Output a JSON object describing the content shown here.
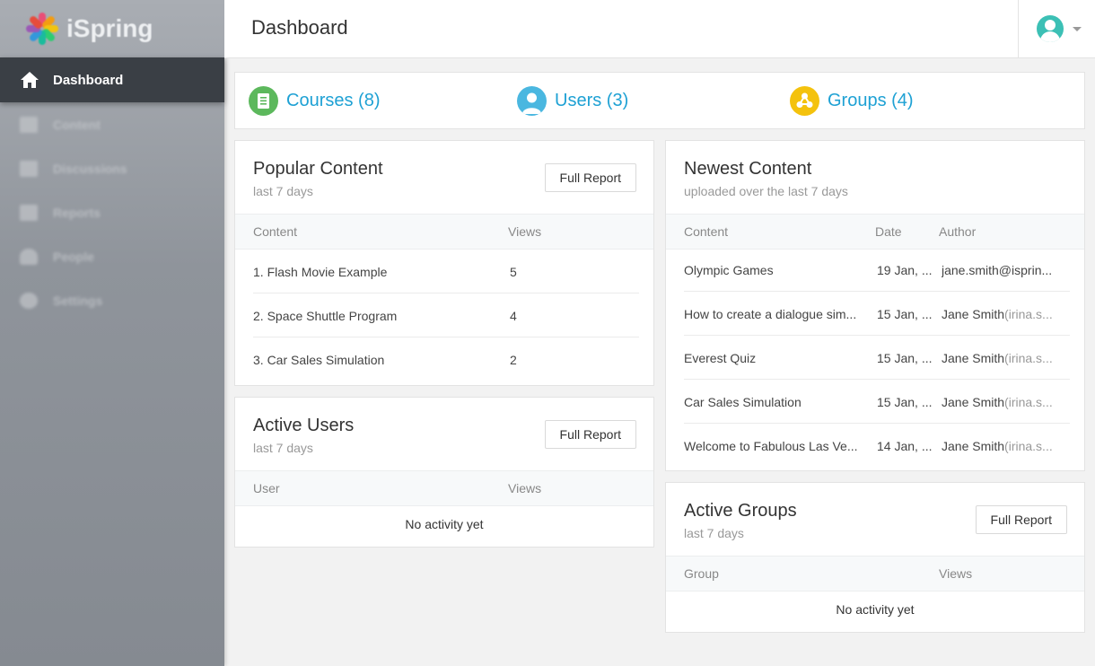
{
  "brand": {
    "name": "iSpring"
  },
  "sidebar": {
    "items": [
      {
        "label": "Dashboard",
        "icon": "home-icon",
        "active": true
      },
      {
        "label": "Content",
        "icon": "content-icon"
      },
      {
        "label": "Discussions",
        "icon": "discussions-icon"
      },
      {
        "label": "Reports",
        "icon": "reports-icon"
      },
      {
        "label": "People",
        "icon": "people-icon"
      },
      {
        "label": "Settings",
        "icon": "settings-icon"
      }
    ]
  },
  "header": {
    "title": "Dashboard"
  },
  "summary": {
    "courses": "Courses (8)",
    "users": "Users (3)",
    "groups": "Groups (4)"
  },
  "colors": {
    "courses": "#5cb85c",
    "users": "#4ab7e0",
    "groups": "#f4c20d",
    "link": "#1ea1d4"
  },
  "popular": {
    "title": "Popular Content",
    "subtitle": "last 7 days",
    "button": "Full Report",
    "col_content": "Content",
    "col_views": "Views",
    "rows": [
      {
        "content": "1. Flash Movie Example",
        "views": "5"
      },
      {
        "content": "2. Space Shuttle Program",
        "views": "4"
      },
      {
        "content": "3. Car Sales Simulation",
        "views": "2"
      }
    ]
  },
  "active_users": {
    "title": "Active Users",
    "subtitle": "last 7 days",
    "button": "Full Report",
    "col_user": "User",
    "col_views": "Views",
    "empty": "No activity yet"
  },
  "newest": {
    "title": "Newest Content",
    "subtitle": "uploaded over the last 7 days",
    "col_content": "Content",
    "col_date": "Date",
    "col_author": "Author",
    "rows": [
      {
        "content": "Olympic Games",
        "date": "19 Jan, ...",
        "author": "jane.smith@isprin...",
        "author_extra": ""
      },
      {
        "content": "How to create a dialogue sim...",
        "date": "15 Jan, ...",
        "author": "Jane Smith",
        "author_extra": "(irina.s..."
      },
      {
        "content": "Everest Quiz",
        "date": "15 Jan, ...",
        "author": "Jane Smith",
        "author_extra": "(irina.s..."
      },
      {
        "content": "Car Sales Simulation",
        "date": "15 Jan, ...",
        "author": "Jane Smith",
        "author_extra": "(irina.s..."
      },
      {
        "content": "Welcome to Fabulous Las Ve...",
        "date": "14 Jan, ...",
        "author": "Jane Smith",
        "author_extra": "(irina.s..."
      }
    ]
  },
  "active_groups": {
    "title": "Active Groups",
    "subtitle": "last 7 days",
    "button": "Full Report",
    "col_group": "Group",
    "col_views": "Views",
    "empty": "No activity yet"
  }
}
